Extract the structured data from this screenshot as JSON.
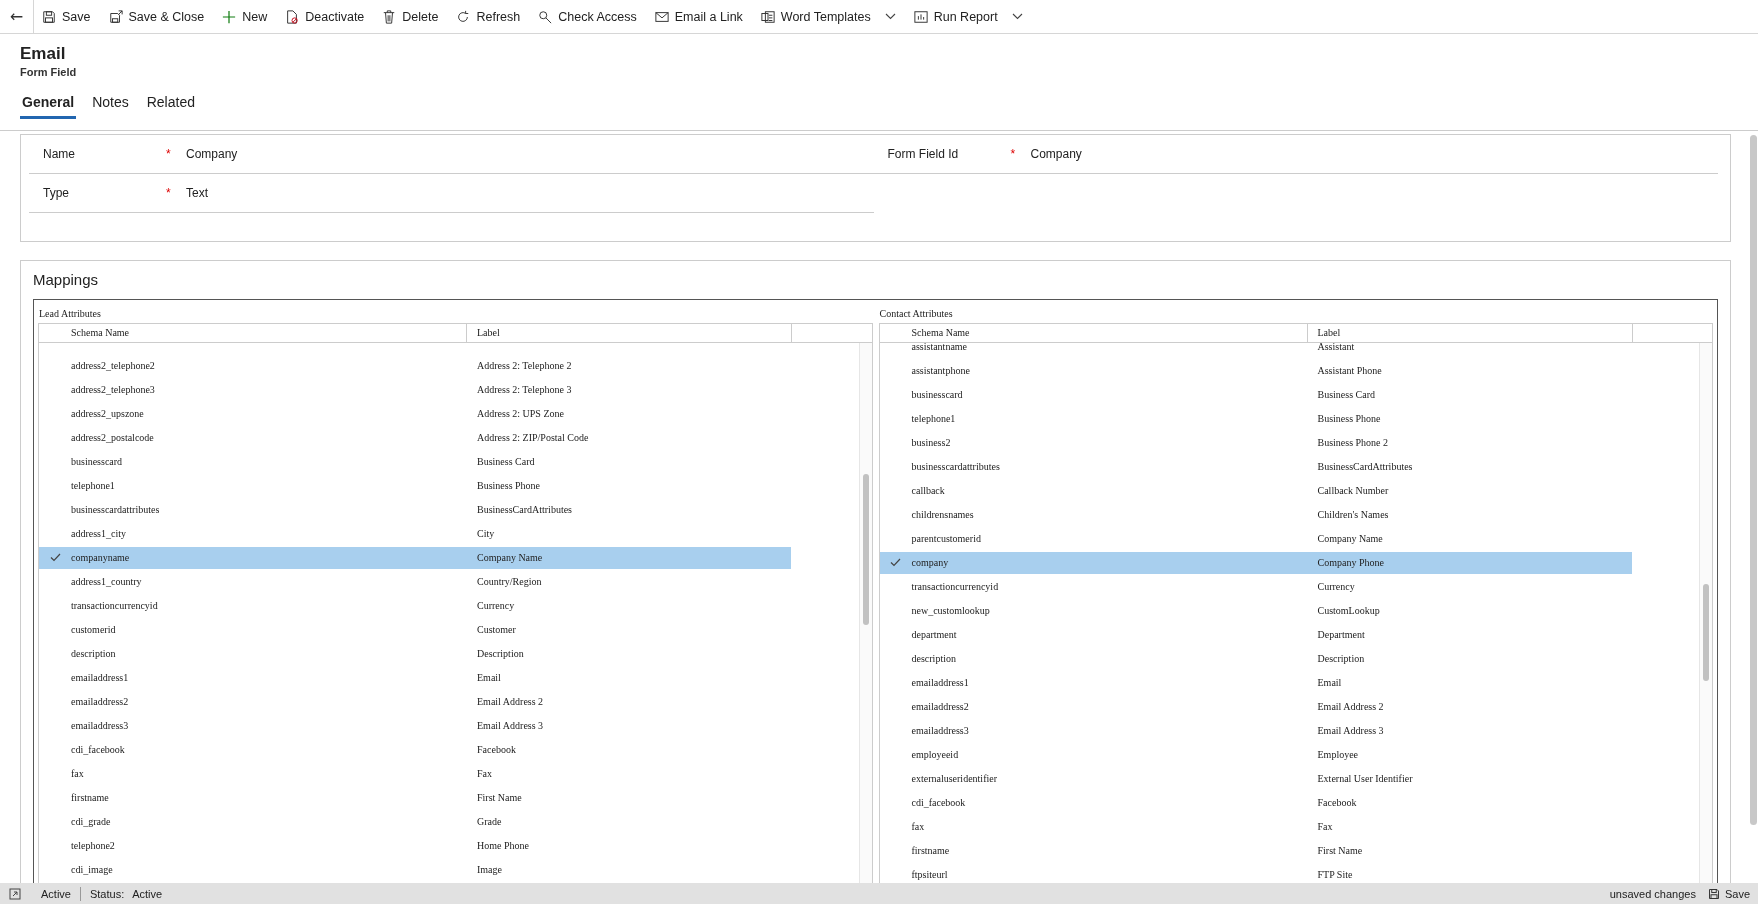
{
  "toolbar": {
    "back": "←",
    "items": [
      {
        "kind": "save",
        "label": "Save",
        "dropdown": false
      },
      {
        "kind": "save-close",
        "label": "Save & Close",
        "dropdown": false
      },
      {
        "kind": "new",
        "label": "New",
        "dropdown": false
      },
      {
        "kind": "deactivate",
        "label": "Deactivate",
        "dropdown": false
      },
      {
        "kind": "delete",
        "label": "Delete",
        "dropdown": false
      },
      {
        "kind": "refresh",
        "label": "Refresh",
        "dropdown": false
      },
      {
        "kind": "check-access",
        "label": "Check Access",
        "dropdown": false
      },
      {
        "kind": "email-link",
        "label": "Email a Link",
        "dropdown": false
      },
      {
        "kind": "word-templates",
        "label": "Word Templates",
        "dropdown": true
      },
      {
        "kind": "run-report",
        "label": "Run Report",
        "dropdown": true
      }
    ]
  },
  "required_mark": "*",
  "header": {
    "title": "Email",
    "subtitle": "Form Field"
  },
  "tabs": [
    {
      "label": "General",
      "selected": true
    },
    {
      "label": "Notes",
      "selected": false
    },
    {
      "label": "Related",
      "selected": false
    }
  ],
  "fields_left": [
    {
      "label": "Name",
      "required": true,
      "value": "Company"
    },
    {
      "label": "Type",
      "required": true,
      "value": "Text"
    }
  ],
  "fields_right": [
    {
      "label": "Form Field Id",
      "required": true,
      "value": "Company"
    }
  ],
  "mappings": {
    "title": "Mappings",
    "tables": [
      {
        "caption": "Lead Attributes",
        "columns": [
          "Schema Name",
          "Label"
        ],
        "rows": [
          {
            "schema_name": "address2_telephone2",
            "label": "Address 2: Telephone 2",
            "selected": false
          },
          {
            "schema_name": "address2_telephone3",
            "label": "Address 2: Telephone 3",
            "selected": false
          },
          {
            "schema_name": "address2_upszone",
            "label": "Address 2: UPS Zone",
            "selected": false
          },
          {
            "schema_name": "address2_postalcode",
            "label": "Address 2: ZIP/Postal Code",
            "selected": false
          },
          {
            "schema_name": "businesscard",
            "label": "Business Card",
            "selected": false
          },
          {
            "schema_name": "telephone1",
            "label": "Business Phone",
            "selected": false
          },
          {
            "schema_name": "businesscardattributes",
            "label": "BusinessCardAttributes",
            "selected": false
          },
          {
            "schema_name": "address1_city",
            "label": "City",
            "selected": false
          },
          {
            "schema_name": "companyname",
            "label": "Company Name",
            "selected": true
          },
          {
            "schema_name": "address1_country",
            "label": "Country/Region",
            "selected": false
          },
          {
            "schema_name": "transactioncurrencyid",
            "label": "Currency",
            "selected": false
          },
          {
            "schema_name": "customerid",
            "label": "Customer",
            "selected": false
          },
          {
            "schema_name": "description",
            "label": "Description",
            "selected": false
          },
          {
            "schema_name": "emailaddress1",
            "label": "Email",
            "selected": false
          },
          {
            "schema_name": "emailaddress2",
            "label": "Email Address 2",
            "selected": false
          },
          {
            "schema_name": "emailaddress3",
            "label": "Email Address 3",
            "selected": false
          },
          {
            "schema_name": "cdi_facebook",
            "label": "Facebook",
            "selected": false
          },
          {
            "schema_name": "fax",
            "label": "Fax",
            "selected": false
          },
          {
            "schema_name": "firstname",
            "label": "First Name",
            "selected": false
          },
          {
            "schema_name": "cdi_grade",
            "label": "Grade",
            "selected": false
          },
          {
            "schema_name": "telephone2",
            "label": "Home Phone",
            "selected": false
          },
          {
            "schema_name": "cdi_image",
            "label": "Image",
            "selected": false
          }
        ]
      },
      {
        "caption": "Contact Attributes",
        "columns": [
          "Schema Name",
          "Label"
        ],
        "rows": [
          {
            "schema_name": "assistantname",
            "label": "Assistant",
            "selected": false
          },
          {
            "schema_name": "assistantphone",
            "label": "Assistant Phone",
            "selected": false
          },
          {
            "schema_name": "businesscard",
            "label": "Business Card",
            "selected": false
          },
          {
            "schema_name": "telephone1",
            "label": "Business Phone",
            "selected": false
          },
          {
            "schema_name": "business2",
            "label": "Business Phone 2",
            "selected": false
          },
          {
            "schema_name": "businesscardattributes",
            "label": "BusinessCardAttributes",
            "selected": false
          },
          {
            "schema_name": "callback",
            "label": "Callback Number",
            "selected": false
          },
          {
            "schema_name": "childrensnames",
            "label": "Children's Names",
            "selected": false
          },
          {
            "schema_name": "parentcustomerid",
            "label": "Company Name",
            "selected": false
          },
          {
            "schema_name": "company",
            "label": "Company Phone",
            "selected": true
          },
          {
            "schema_name": "transactioncurrencyid",
            "label": "Currency",
            "selected": false
          },
          {
            "schema_name": "new_customlookup",
            "label": "CustomLookup",
            "selected": false
          },
          {
            "schema_name": "department",
            "label": "Department",
            "selected": false
          },
          {
            "schema_name": "description",
            "label": "Description",
            "selected": false
          },
          {
            "schema_name": "emailaddress1",
            "label": "Email",
            "selected": false
          },
          {
            "schema_name": "emailaddress2",
            "label": "Email Address 2",
            "selected": false
          },
          {
            "schema_name": "emailaddress3",
            "label": "Email Address 3",
            "selected": false
          },
          {
            "schema_name": "employeeid",
            "label": "Employee",
            "selected": false
          },
          {
            "schema_name": "externaluseridentifier",
            "label": "External User Identifier",
            "selected": false
          },
          {
            "schema_name": "cdi_facebook",
            "label": "Facebook",
            "selected": false
          },
          {
            "schema_name": "fax",
            "label": "Fax",
            "selected": false
          },
          {
            "schema_name": "firstname",
            "label": "First Name",
            "selected": false
          },
          {
            "schema_name": "ftpsiteurl",
            "label": "FTP Site",
            "selected": false
          }
        ]
      }
    ]
  },
  "status_bar": {
    "state": "Active",
    "status_label": "Status:",
    "status_value": "Active",
    "unsaved": "unsaved changes",
    "save": "Save"
  }
}
